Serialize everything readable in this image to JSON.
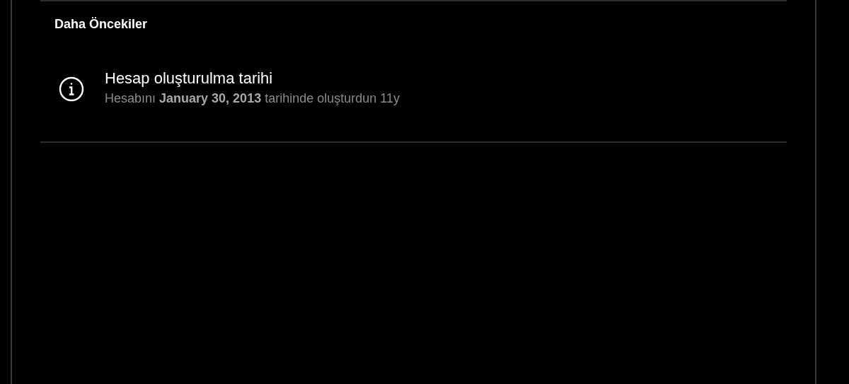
{
  "section": {
    "heading": "Daha Öncekiler",
    "items": [
      {
        "title": "Hesap oluşturulma tarihi",
        "description": "Hesabını **January 30, 2013** tarihinde oluşturdun 11y"
      }
    ]
  }
}
